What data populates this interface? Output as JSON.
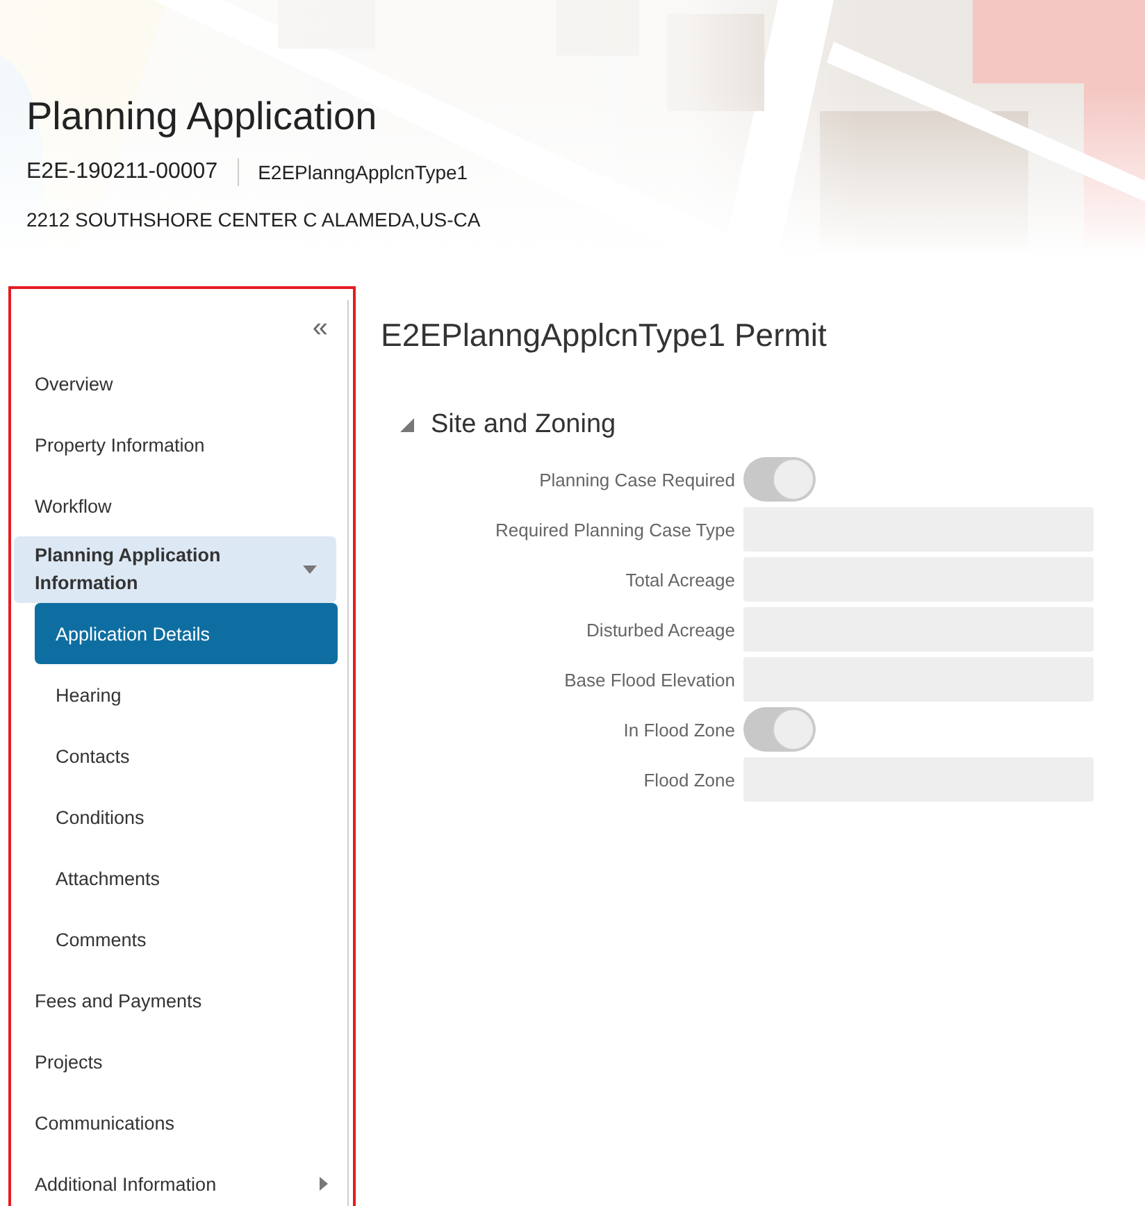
{
  "header": {
    "title": "Planning Application",
    "record_id": "E2E-190211-00007",
    "record_type": "E2EPlanngApplcnType1",
    "address": "2212 SOUTHSHORE CENTER C ALAMEDA,US-CA"
  },
  "sidebar": {
    "collapse": "«",
    "items": [
      {
        "kind": "item",
        "label": "Overview",
        "selected": false
      },
      {
        "kind": "item",
        "label": "Property Information",
        "selected": false
      },
      {
        "kind": "item",
        "label": "Workflow",
        "selected": false
      },
      {
        "kind": "group",
        "label": "Planning Application Information",
        "expanded": true,
        "children": [
          {
            "label": "Application Details",
            "selected": true
          },
          {
            "label": "Hearing",
            "selected": false
          },
          {
            "label": "Contacts",
            "selected": false
          },
          {
            "label": "Conditions",
            "selected": false
          },
          {
            "label": "Attachments",
            "selected": false
          },
          {
            "label": "Comments",
            "selected": false
          }
        ]
      },
      {
        "kind": "item",
        "label": "Fees and Payments",
        "selected": false
      },
      {
        "kind": "item",
        "label": "Projects",
        "selected": false
      },
      {
        "kind": "item",
        "label": "Communications",
        "selected": false
      },
      {
        "kind": "submenu",
        "label": "Additional Information",
        "selected": false
      }
    ]
  },
  "main": {
    "title": "E2EPlanngApplcnType1 Permit",
    "section": {
      "title": "Site and Zoning",
      "expanded": true,
      "fields": [
        {
          "kind": "toggle",
          "label": "Planning Case Required",
          "on": true
        },
        {
          "kind": "text",
          "label": "Required Planning Case Type"
        },
        {
          "kind": "text",
          "label": "Total Acreage"
        },
        {
          "kind": "text",
          "label": "Disturbed Acreage"
        },
        {
          "kind": "text",
          "label": "Base Flood Elevation"
        },
        {
          "kind": "toggle",
          "label": "In Flood Zone",
          "on": true
        },
        {
          "kind": "text",
          "label": "Flood Zone"
        }
      ]
    }
  }
}
